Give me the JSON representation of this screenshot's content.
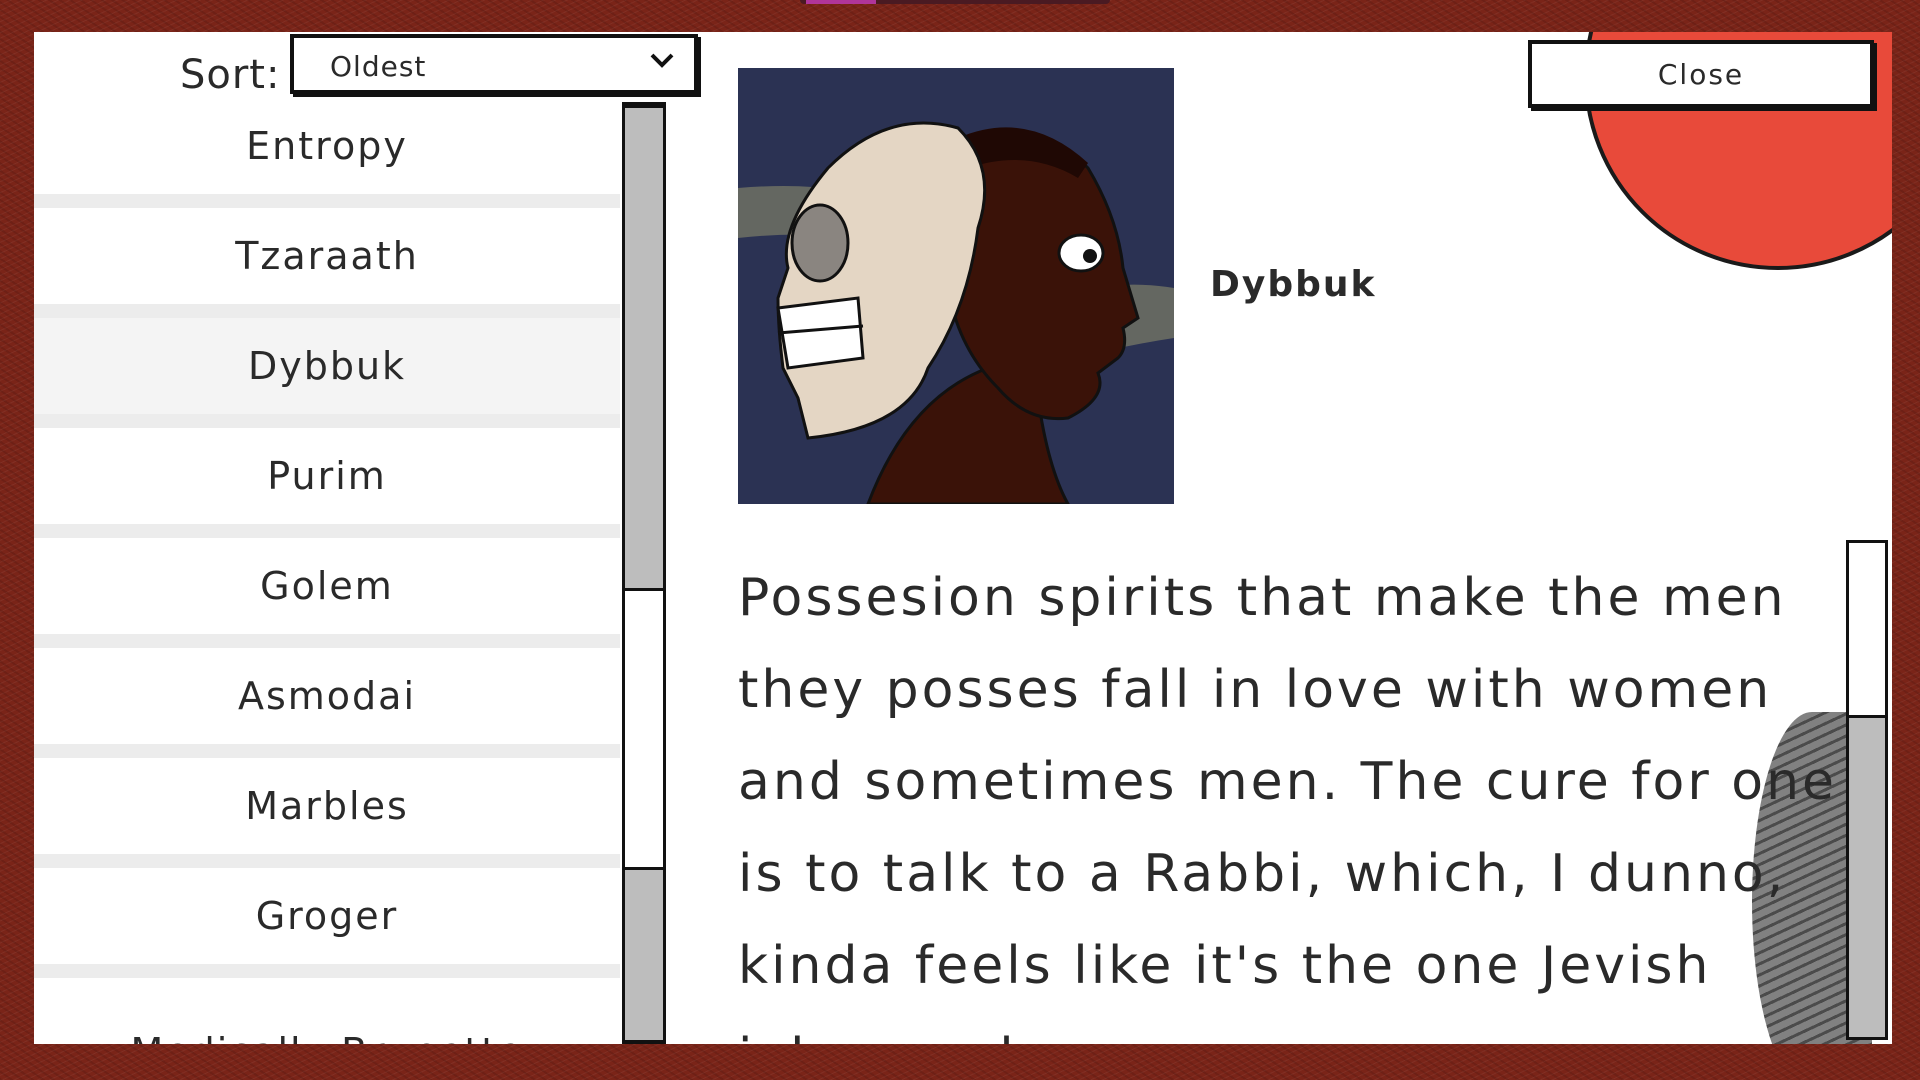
{
  "sort": {
    "label": "Sort:",
    "selected": "Oldest"
  },
  "list": {
    "items": [
      {
        "label": "Entropy"
      },
      {
        "label": "Tzaraath"
      },
      {
        "label": "Dybbuk"
      },
      {
        "label": "Purim"
      },
      {
        "label": "Golem"
      },
      {
        "label": "Asmodai"
      },
      {
        "label": "Marbles"
      },
      {
        "label": "Groger"
      },
      {
        "label": "Medically Brunette"
      }
    ],
    "selected_index": 2
  },
  "detail": {
    "title": "Dybbuk",
    "description": "Possesion spirits that make the men they posses fall in love with women and sometimes men. The cure for one is to talk to a Rabbi, which, I dunno, kinda feels like it's the one Jevish joke ve alvays",
    "portrait_icon": "skull-profile-portrait"
  },
  "close_label": "Close",
  "colors": {
    "frame": "#7a2418",
    "portrait_bg": "#2b3253",
    "accent_red": "#e84a3a"
  }
}
